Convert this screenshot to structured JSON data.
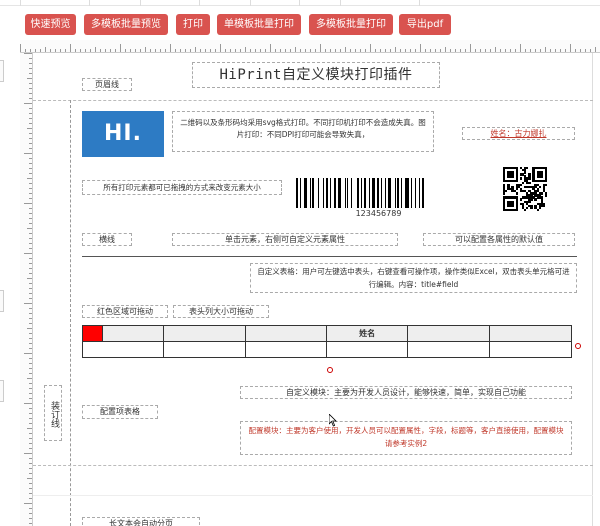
{
  "toolbar": {
    "buttons": [
      "快速预览",
      "多模板批量预览",
      "打印",
      "单模板批量打印",
      "多模板批量打印",
      "导出pdf"
    ],
    "accent_color": "#d9534f"
  },
  "page": {
    "header_line_label": "页眉线",
    "title": "HiPrint自定义模块打印插件",
    "logo_text": "HI.",
    "svg_note": "二维码以及条形码均采用svg格式打印。不同打印机打印不会造成失真。图片打印：不同DPI打印可能会导致失真，",
    "name_label": "姓名：古力娜扎",
    "drag_note": "所有打印元素都可已拖拽的方式来改变元素大小",
    "barcode_value": "123456789",
    "hline_label": "横线",
    "click_note": "单击元素，右侧可自定义元素属性",
    "default_note": "可以配置各属性的默认值",
    "table_note": "自定义表格：用户可左键选中表头，右键查看可操作项，操作类似Excel，双击表头单元格可进行编辑。内容：title#field",
    "red_drag_label": "红色区域可拖动",
    "header_resize_label": "表头列大小可拖动",
    "table_header_name": "姓名",
    "custom_module_note": "自定义模块：主要为开发人员设计，能够快速，简单，实现自己功能",
    "binding_label": "装订线",
    "config_table_label": "配置项表格",
    "config_module_note": "配置模块：主要为客户使用，开发人员可以配置属性，字段，标题等，客户直接使用，配置模块请参考实例2",
    "long_text_label": "长文本会自动分页"
  }
}
